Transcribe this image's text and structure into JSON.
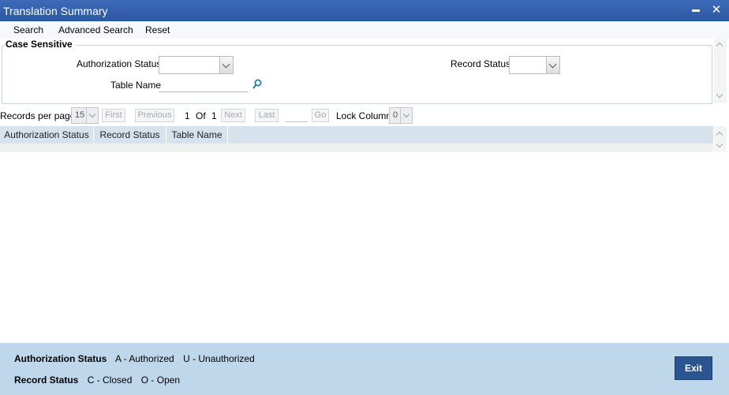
{
  "window": {
    "title": "Translation Summary"
  },
  "toolbar": {
    "search": "Search",
    "advanced_search": "Advanced Search",
    "reset": "Reset"
  },
  "criteria": {
    "legend": "Case Sensitive",
    "authorization_status_label": "Authorization Status",
    "authorization_status_value": "",
    "record_status_label": "Record Status",
    "record_status_value": "",
    "table_name_label": "Table Name",
    "table_name_value": ""
  },
  "pager": {
    "records_per_page_label": "Records per page",
    "records_per_page_value": "15",
    "first": "First",
    "previous": "Previous",
    "current_page": "1",
    "of": "Of",
    "total_pages": "1",
    "next": "Next",
    "last": "Last",
    "go": "Go",
    "lock_columns_label": "Lock Columns",
    "lock_columns_value": "0"
  },
  "grid": {
    "columns": [
      "Authorization Status",
      "Record Status",
      "Table Name"
    ]
  },
  "footer": {
    "auth_label": "Authorization Status",
    "auth_items": [
      "A - Authorized",
      "U - Unauthorized"
    ],
    "record_label": "Record Status",
    "record_items": [
      "C - Closed",
      "O - Open"
    ],
    "exit": "Exit"
  }
}
